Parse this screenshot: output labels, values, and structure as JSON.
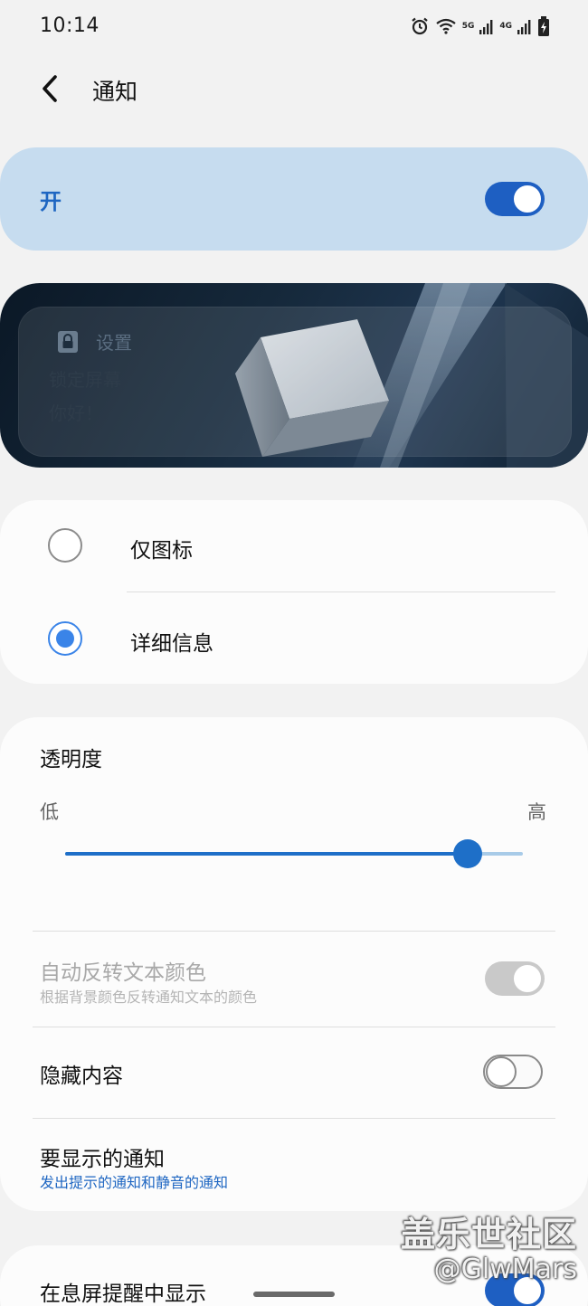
{
  "status_bar": {
    "time": "10:14",
    "net1": "5G",
    "net2": "4G",
    "icons": [
      "alarm-icon",
      "wifi-icon",
      "signal-icon",
      "battery-charging-icon"
    ]
  },
  "header": {
    "title": "通知"
  },
  "master_switch": {
    "label": "开",
    "on": true
  },
  "preview": {
    "settings": "设置",
    "line1": "锁定屏幕",
    "line2": "你好！"
  },
  "style_options": [
    {
      "label": "仅图标",
      "selected": false
    },
    {
      "label": "详细信息",
      "selected": true
    }
  ],
  "transparency": {
    "title": "透明度",
    "low": "低",
    "high": "高",
    "value": 0.88
  },
  "auto_invert": {
    "title": "自动反转文本颜色",
    "subtitle": "根据背景颜色反转通知文本的颜色",
    "enabled": false,
    "on": true
  },
  "hide_content": {
    "title": "隐藏内容",
    "on": false
  },
  "notifications_to_show": {
    "title": "要显示的通知",
    "subtitle": "发出提示的通知和静音的通知"
  },
  "show_on_aod": {
    "title": "在息屏提醒中显示",
    "on": true
  },
  "watermark": {
    "line1": "盖乐世社区",
    "line2": "@GlwMars"
  },
  "colors": {
    "accent": "#1e5fc2",
    "card_highlight": "#c6dcef",
    "background": "#f2f2f2"
  }
}
